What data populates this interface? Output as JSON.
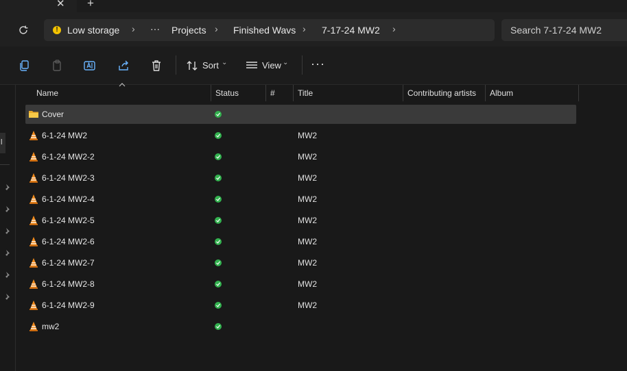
{
  "window": {
    "new_tab_glyph": "+",
    "close_tab_glyph": "✕"
  },
  "address": {
    "warning_label": "Low storage",
    "overflow": "···",
    "crumbs": [
      "Projects",
      "Finished Wavs",
      "7-17-24 MW2"
    ],
    "search_placeholder": "Search 7-17-24 MW2"
  },
  "toolbar": {
    "sort_label": "Sort",
    "view_label": "View",
    "more_label": "···"
  },
  "columns": {
    "name": "Name",
    "status": "Status",
    "number": "#",
    "title": "Title",
    "artists": "Contributing artists",
    "album": "Album"
  },
  "files": [
    {
      "name": "Cover",
      "kind": "folder-icon",
      "title": ""
    },
    {
      "name": "6-1-24 MW2",
      "kind": "vlc-media-icon",
      "title": "MW2"
    },
    {
      "name": "6-1-24 MW2-2",
      "kind": "vlc-media-icon",
      "title": "MW2"
    },
    {
      "name": "6-1-24 MW2-3",
      "kind": "vlc-media-icon",
      "title": "MW2"
    },
    {
      "name": "6-1-24 MW2-4",
      "kind": "vlc-media-icon",
      "title": "MW2"
    },
    {
      "name": "6-1-24 MW2-5",
      "kind": "vlc-media-icon",
      "title": "MW2"
    },
    {
      "name": "6-1-24 MW2-6",
      "kind": "vlc-media-icon",
      "title": "MW2"
    },
    {
      "name": "6-1-24 MW2-7",
      "kind": "vlc-media-icon",
      "title": "MW2"
    },
    {
      "name": "6-1-24 MW2-8",
      "kind": "vlc-media-icon",
      "title": "MW2"
    },
    {
      "name": "6-1-24 MW2-9",
      "kind": "vlc-media-icon",
      "title": "MW2"
    },
    {
      "name": "mw2",
      "kind": "vlc-media-icon",
      "title": ""
    }
  ],
  "nav": {
    "selected_glyph": "l"
  },
  "colors": {
    "accent_status": "#33b24f",
    "warning": "#f2c200",
    "vlc_orange": "#f08a1c"
  }
}
